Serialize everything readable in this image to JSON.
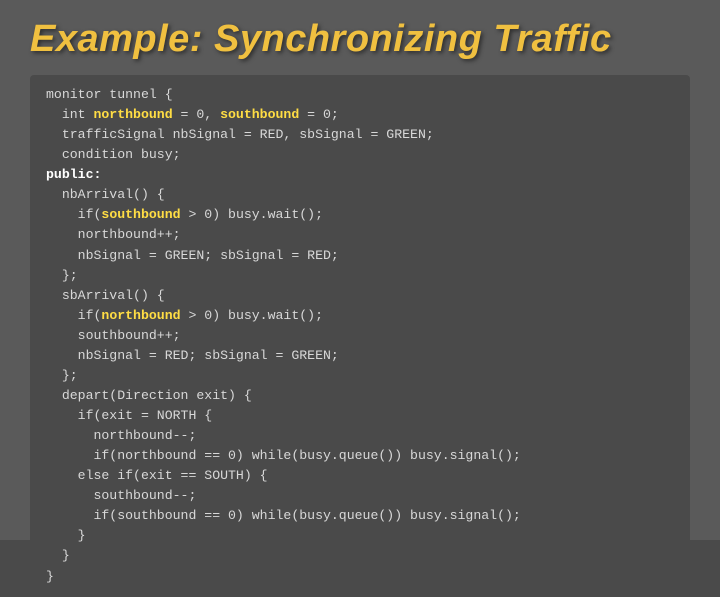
{
  "title": "Example: Synchronizing Traffic",
  "code": {
    "lines": [
      "monitor tunnel {",
      "  int northbound = 0, southbound = 0;",
      "  trafficSignal nbSignal = RED, sbSignal = GREEN;",
      "  condition busy;",
      "public:",
      "  nbArrival() {",
      "    if(southbound > 0) busy.wait();",
      "    northbound++;",
      "    nbSignal = GREEN; sbSignal = RED;",
      "  };",
      "  sbArrival() {",
      "    if(northbound > 0) busy.wait();",
      "    southbound++;",
      "    nbSignal = RED; sbSignal = GREEN;",
      "  };",
      "  depart(Direction exit) {",
      "    if(exit = NORTH {",
      "      northbound--;",
      "      if(northbound == 0) while(busy.queue()) busy.signal();",
      "    else if(exit == SOUTH) {",
      "      southbound--;",
      "      if(southbound == 0) while(busy.queue()) busy.signal();",
      "    }",
      "  }",
      "}"
    ]
  }
}
